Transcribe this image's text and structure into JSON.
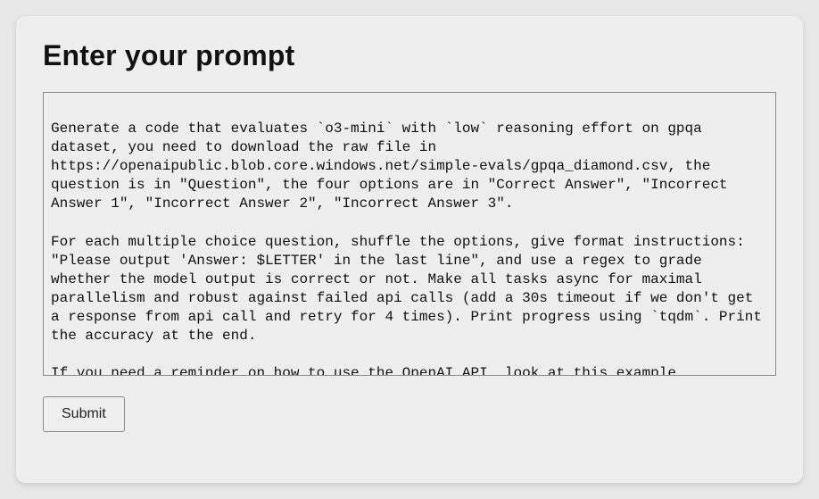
{
  "form": {
    "title": "Enter your prompt",
    "prompt_value": "Generate a code that evaluates `o3-mini` with `low` reasoning effort on gpqa dataset, you need to download the raw file in https://openaipublic.blob.core.windows.net/simple-evals/gpqa_diamond.csv, the question is in \"Question\", the four options are in \"Correct Answer\", \"Incorrect Answer 1\", \"Incorrect Answer 2\", \"Incorrect Answer 3\".\n\nFor each multiple choice question, shuffle the options, give format instructions: \"Please output 'Answer: $LETTER' in the last line\", and use a regex to grade whether the model output is correct or not. Make all tasks async for maximal parallelism and robust against failed api calls (add a 30s timeout if we don't get a response from api call and retry for 4 times). Print progress using `tqdm`. Print the accuracy at the end.\n\nIf you need a reminder on how to use the OpenAI API, look at this example",
    "submit_label": "Submit"
  }
}
